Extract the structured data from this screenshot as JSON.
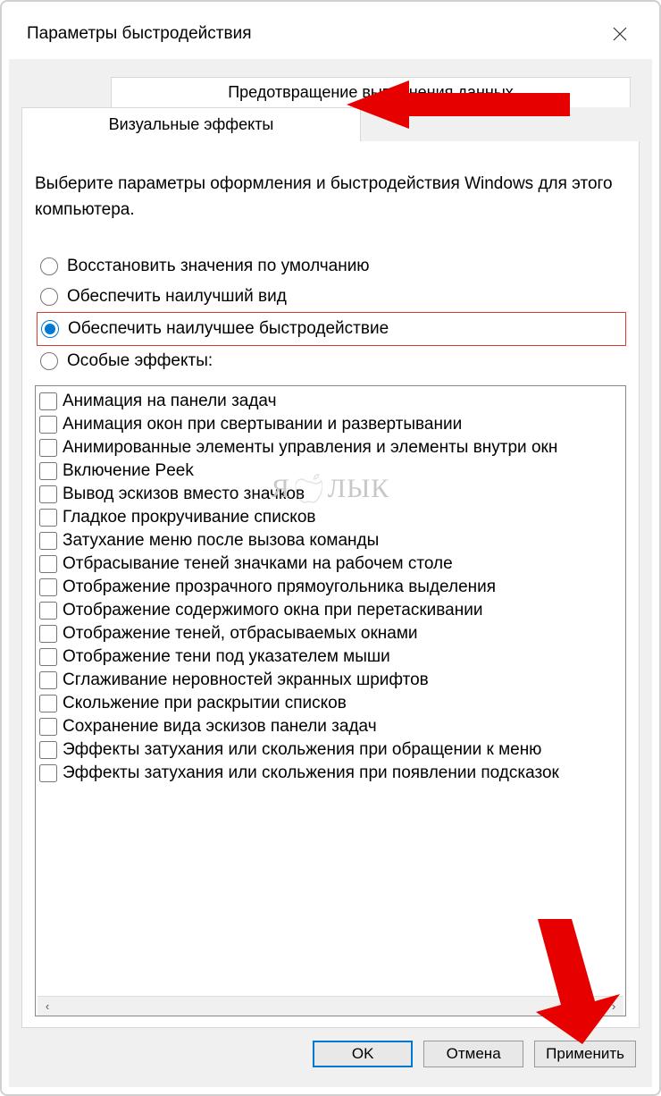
{
  "window": {
    "title": "Параметры быстродействия"
  },
  "tabs": {
    "back": "Предотвращение выполнения данных",
    "front": "Визуальные эффекты"
  },
  "description": "Выберите параметры оформления и быстродействия Windows для этого компьютера.",
  "radios": {
    "restore": "Восстановить значения по умолчанию",
    "best_appearance": "Обеспечить наилучший вид",
    "best_performance": "Обеспечить наилучшее быстродействие",
    "custom": "Особые эффекты:",
    "selected": "best_performance"
  },
  "effects": [
    "Анимация на панели задач",
    "Анимация окон при свертывании и развертывании",
    "Анимированные элементы управления и элементы внутри окн",
    "Включение Peek",
    "Вывод эскизов вместо значков",
    "Гладкое прокручивание списков",
    "Затухание меню после вызова команды",
    "Отбрасывание теней значками на рабочем столе",
    "Отображение прозрачного прямоугольника выделения",
    "Отображение содержимого окна при перетаскивании",
    "Отображение теней, отбрасываемых окнами",
    "Отображение тени под указателем мыши",
    "Сглаживание неровностей экранных шрифтов",
    "Скольжение при раскрытии списков",
    "Сохранение вида эскизов панели задач",
    "Эффекты затухания или скольжения при обращении к меню",
    "Эффекты затухания или скольжения при появлении подсказок"
  ],
  "buttons": {
    "ok": "OK",
    "cancel": "Отмена",
    "apply": "Применить"
  },
  "scroll": {
    "left": "‹",
    "right": "›"
  },
  "watermark": {
    "left": "Я",
    "right": "ЛЫК"
  }
}
